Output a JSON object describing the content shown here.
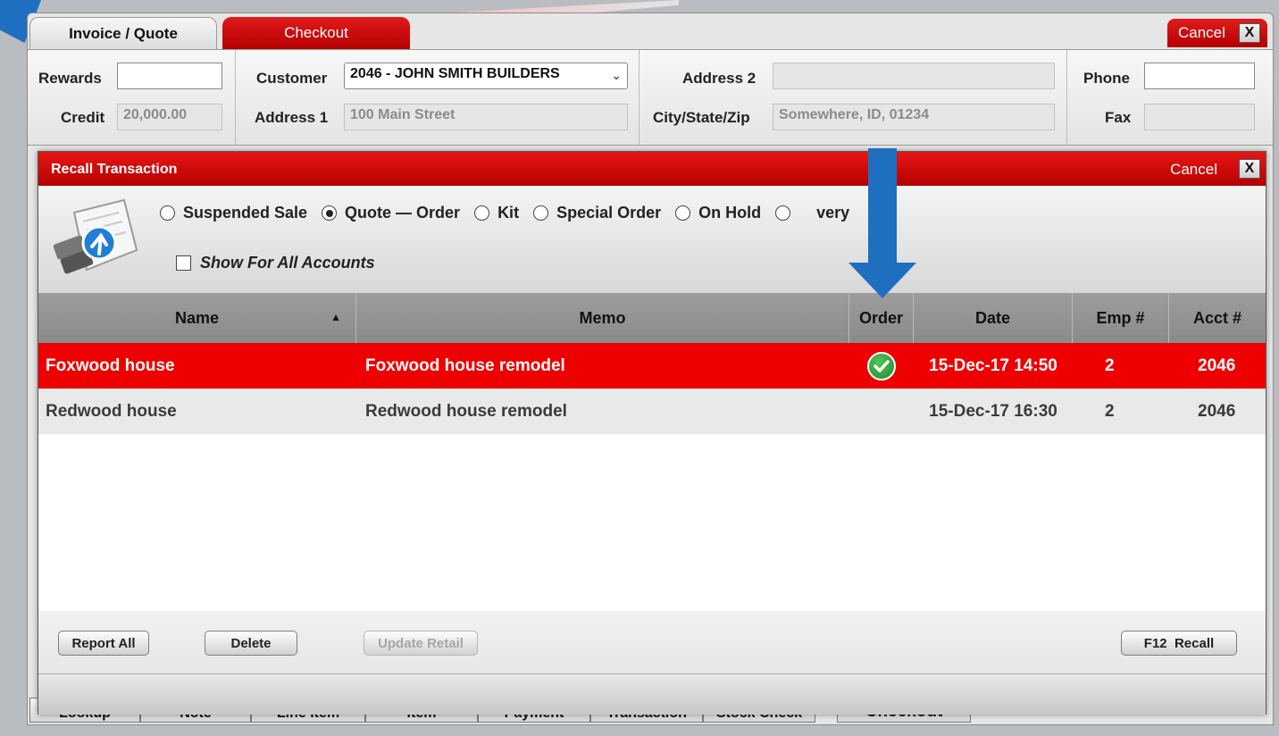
{
  "main": {
    "tabs": [
      {
        "label": "Invoice / Quote"
      },
      {
        "label": "Checkout"
      }
    ],
    "cancel_label": "Cancel",
    "close_glyph": "X",
    "fields": {
      "rewards_label": "Rewards",
      "rewards_value": "",
      "credit_label": "Credit",
      "credit_value": "20,000.00",
      "customer_label": "Customer",
      "customer_value": "2046 - JOHN SMITH BUILDERS",
      "address1_label": "Address 1",
      "address1_value": "100 Main Street",
      "address2_label": "Address 2",
      "address2_value": "",
      "city_label": "City/State/Zip",
      "city_value": "Somewhere, ID, 01234",
      "phone_label": "Phone",
      "phone_value": "",
      "fax_label": "Fax",
      "fax_value": ""
    },
    "toolbar": [
      {
        "label": "Lookup"
      },
      {
        "label": "Note"
      },
      {
        "label": "Line Item"
      },
      {
        "label": "Item"
      },
      {
        "label": "Payment"
      },
      {
        "label": "Transaction"
      },
      {
        "label": "Stock Check"
      },
      {
        "label": "Checkout"
      }
    ]
  },
  "modal": {
    "title": "Recall Transaction",
    "cancel_label": "Cancel",
    "close_glyph": "X",
    "radio_options": [
      {
        "label": "Suspended Sale",
        "selected": false
      },
      {
        "label": "Quote — Order",
        "selected": true
      },
      {
        "label": "Kit",
        "selected": false
      },
      {
        "label": "Special Order",
        "selected": false
      },
      {
        "label": "On Hold",
        "selected": false
      },
      {
        "label": "Delivery",
        "selected": false
      }
    ],
    "radio_visible_fragment": "very",
    "show_all_label": "Show For All Accounts",
    "columns": {
      "name": "Name",
      "memo": "Memo",
      "order": "Order",
      "date": "Date",
      "emp": "Emp #",
      "acct": "Acct #"
    },
    "rows": [
      {
        "name": "Foxwood house",
        "memo": "Foxwood house remodel",
        "order": true,
        "date": "15-Dec-17 14:50",
        "emp": "2",
        "acct": "2046"
      },
      {
        "name": "Redwood house",
        "memo": "Redwood house remodel",
        "order": false,
        "date": "15-Dec-17 16:30",
        "emp": "2",
        "acct": "2046"
      }
    ],
    "buttons": {
      "report_all": "Report All",
      "delete": "Delete",
      "update_retail": "Update Retail",
      "recall": "F12  Recall"
    }
  },
  "colors": {
    "accent_red": "#e81616",
    "annotation_blue": "#1f6fc0",
    "check_green": "#2a9a36"
  }
}
